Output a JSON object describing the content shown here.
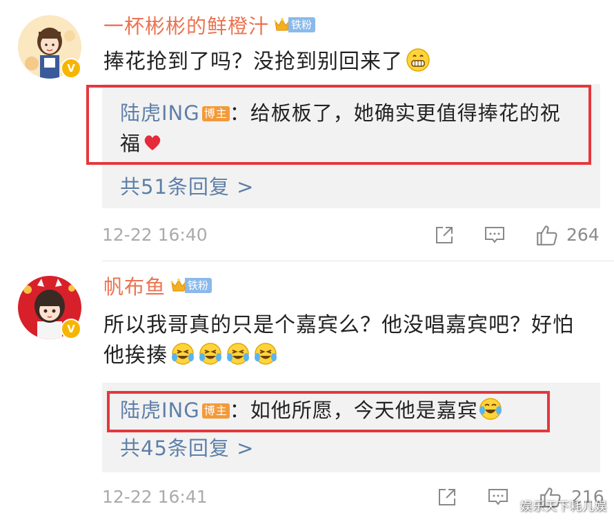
{
  "comments": [
    {
      "username": "一杯彬彬的鲜橙汁",
      "fan_badge": "铁粉",
      "verified_badge": "V",
      "text": "捧花抢到了吗？没抢到别回来了",
      "emoji_icon": "grinning-emoji",
      "reply": {
        "author": "陆虎ING",
        "author_badge": "博主",
        "separator": "：",
        "text": "给板板了，她确实更值得捧花的祝福",
        "emoji_icon": "red-heart-emoji"
      },
      "reply_count_label": "共51条回复 >",
      "timestamp": "12-22 16:40",
      "like_count": "264"
    },
    {
      "username": "帆布鱼",
      "fan_badge": "铁粉",
      "verified_badge": "V",
      "text": "所以我哥真的只是个嘉宾么？他没唱嘉宾吧？好怕他挨揍",
      "emoji_icons": [
        "laugh-cry-emoji",
        "laugh-cry-emoji",
        "laugh-cry-emoji",
        "laugh-cry-emoji"
      ],
      "reply": {
        "author": "陆虎ING",
        "author_badge": "博主",
        "separator": "：",
        "text": "如他所愿，今天他是嘉宾",
        "emoji_icon": "tears-of-joy-emoji"
      },
      "reply_count_label": "共45条回复 >",
      "timestamp": "12-22 16:41",
      "like_count": "216"
    }
  ],
  "watermark": "娱乐天下耗儿娱",
  "colors": {
    "username": "#eb7350",
    "reply_author": "#5d7fa8",
    "highlight_border": "#e5373d",
    "reply_bg": "#f2f2f2",
    "host_badge": "#f29a3a",
    "fan_badge": "#8ab9ea"
  }
}
